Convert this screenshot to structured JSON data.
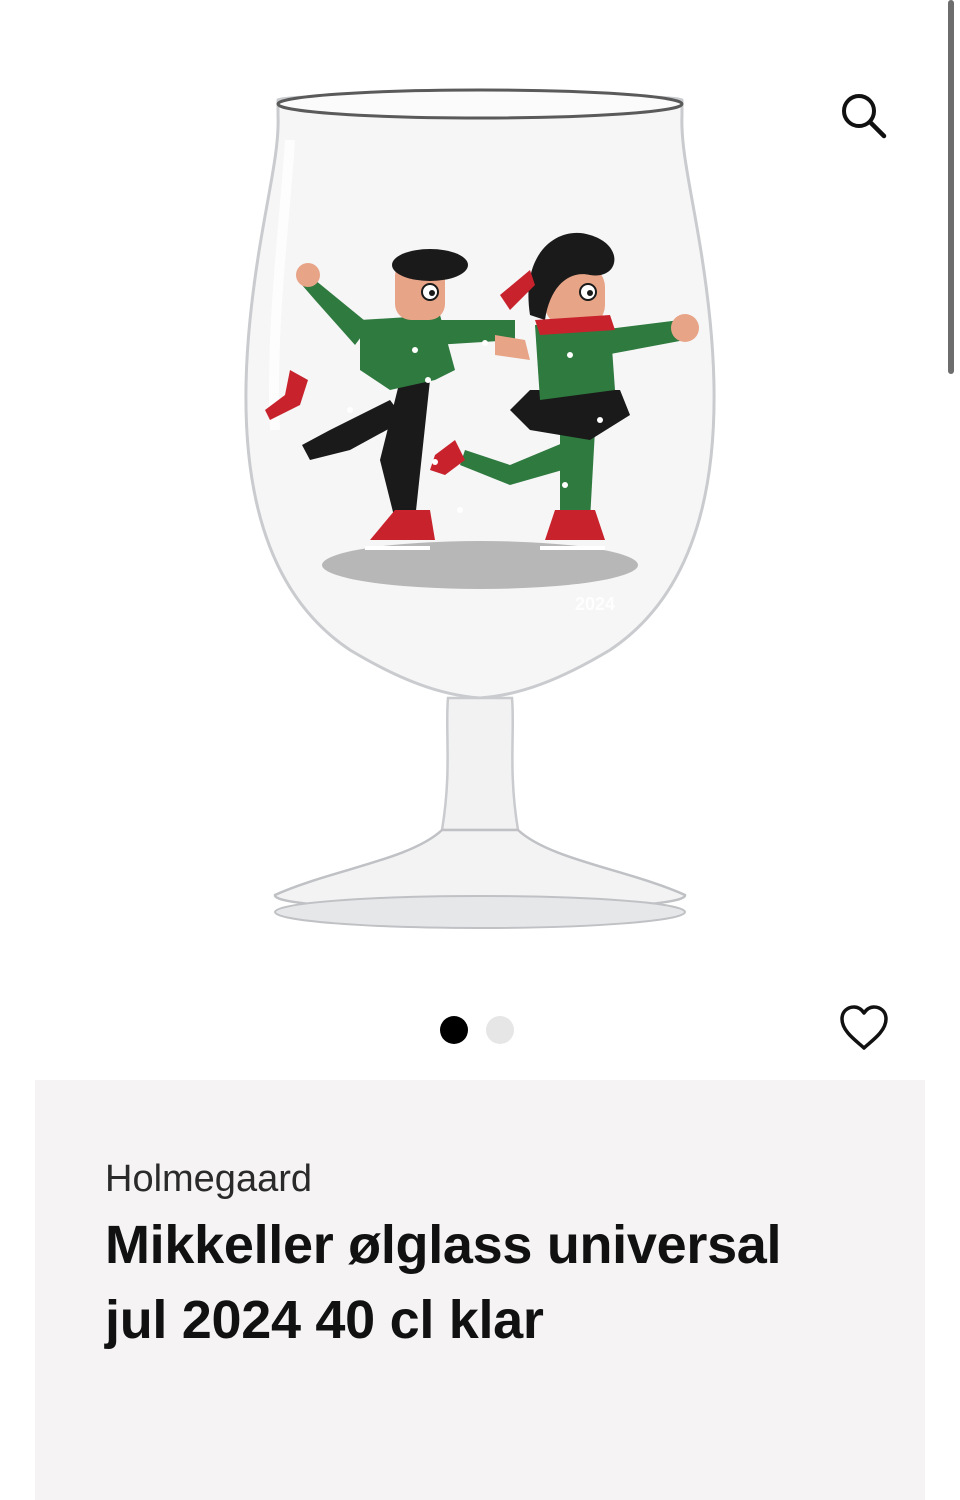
{
  "product": {
    "brand": "Holmegaard",
    "title": "Mikkeller ølglass universal jul 2024 40 cl klar",
    "glass_print_year": "2024"
  },
  "gallery": {
    "slides": [
      "image-1",
      "image-2"
    ],
    "active_index": 0
  },
  "icons": {
    "search": "search-icon",
    "favorite": "heart-icon"
  },
  "colors": {
    "card_background": "#f5f3f3",
    "dot_active": "#000000",
    "dot_inactive": "#e6e6e6",
    "sweater_green": "#2f7a3f",
    "skate_red": "#c8232c"
  }
}
